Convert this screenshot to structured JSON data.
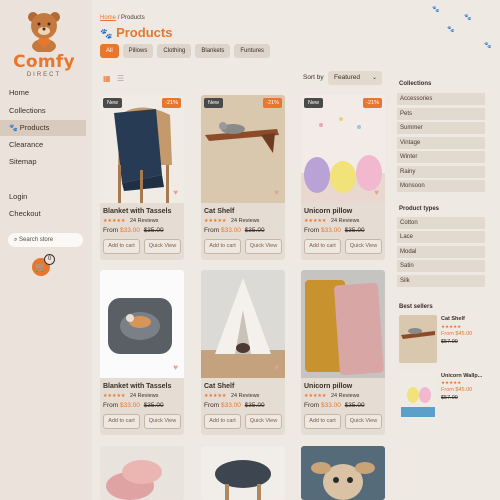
{
  "brand": {
    "name": "Comfy",
    "sub": "DIRECT"
  },
  "nav": [
    {
      "label": "Home"
    },
    {
      "label": "Collections"
    },
    {
      "label": "Products"
    },
    {
      "label": "Clearance"
    },
    {
      "label": "Sitemap"
    },
    {
      "label": "Login"
    },
    {
      "label": "Checkout"
    }
  ],
  "search": {
    "placeholder": "Search store"
  },
  "cart": {
    "count": "0"
  },
  "breadcrumb": {
    "home": "Home",
    "sep": "/",
    "current": "Products"
  },
  "page_title": "Products",
  "filters": [
    "All",
    "Pillows",
    "Clothing",
    "Blankets",
    "Funtures"
  ],
  "sort": {
    "label": "Sort by",
    "value": "Featured"
  },
  "products": [
    {
      "name": "Blanket with Tassels",
      "stars": "★★★★★",
      "reviews": "24 Reviews",
      "from": "From",
      "price": "$33.00",
      "was": "$35.00",
      "new": "New",
      "off": "-21%",
      "add": "Add to cart",
      "quick": "Quick View"
    },
    {
      "name": "Cat Shelf",
      "stars": "★★★★★",
      "reviews": "24 Reviews",
      "from": "From",
      "price": "$33.00",
      "was": "$35.00",
      "new": "New",
      "off": "-21%",
      "add": "Add to cart",
      "quick": "Quick View"
    },
    {
      "name": "Unicorn pillow",
      "stars": "★★★★★",
      "reviews": "24 Reviews",
      "from": "From",
      "price": "$33.00",
      "was": "$35.00",
      "new": "New",
      "off": "-21%",
      "add": "Add to cart",
      "quick": "Quick View"
    },
    {
      "name": "Blanket with Tassels",
      "stars": "★★★★★",
      "reviews": "24 Reviews",
      "from": "From",
      "price": "$33.00",
      "was": "$35.00",
      "new": "",
      "off": "",
      "add": "Add to cart",
      "quick": "Quick View"
    },
    {
      "name": "Cat Shelf",
      "stars": "★★★★★",
      "reviews": "24 Reviews",
      "from": "From",
      "price": "$33.00",
      "was": "$35.00",
      "new": "",
      "off": "",
      "add": "Add to cart",
      "quick": "Quick View"
    },
    {
      "name": "Unicorn pillow",
      "stars": "★★★★★",
      "reviews": "24 Reviews",
      "from": "From",
      "price": "$33.00",
      "was": "$35.00",
      "new": "",
      "off": "",
      "add": "Add to cart",
      "quick": "Quick View"
    }
  ],
  "collections": {
    "title": "Collections",
    "items": [
      "Accessories",
      "Pets",
      "Summer",
      "Vintage",
      "Winter",
      "Rainy",
      "Monsoon"
    ]
  },
  "product_types": {
    "title": "Product types",
    "items": [
      "Cotton",
      "Lace",
      "Modal",
      "Satin",
      "Silk"
    ]
  },
  "best_sellers": {
    "title": "Best sellers",
    "items": [
      {
        "name": "Cat Shelf",
        "stars": "★★★★★",
        "price": "From $45.00",
        "was": "$57.00"
      },
      {
        "name": "Unicorn Wallp...",
        "stars": "★★★★★",
        "price": "From $45.00",
        "was": "$57.00"
      }
    ]
  },
  "colors": {
    "accent": "#e8762c",
    "bg": "#efe9e3",
    "sidebar": "#ebe3db",
    "card": "#e5ddd3"
  }
}
